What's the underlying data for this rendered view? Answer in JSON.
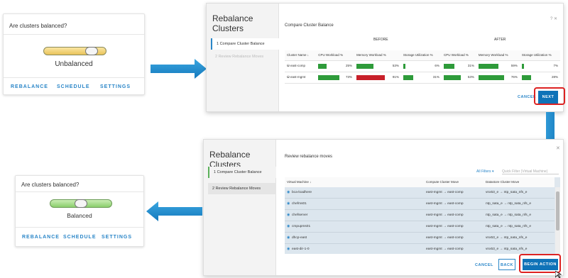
{
  "top_card": {
    "question": "Are clusters balanced?",
    "status": "Unbalanced",
    "actions": [
      "REBALANCE",
      "SCHEDULE",
      "SETTINGS"
    ]
  },
  "bottom_card": {
    "question": "Are clusters balanced?",
    "status": "Balanced",
    "actions": [
      "REBALANCE",
      "SCHEDULE",
      "SETTINGS"
    ]
  },
  "dialog1": {
    "title": "Rebalance Clusters",
    "steps": [
      "1  Compare Cluster Balance",
      "2  Review Rebalance Moves"
    ],
    "subtitle": "Compare Cluster Balance",
    "close": "? ✕",
    "group_before": "BEFORE",
    "group_after": "AFTER",
    "columns": [
      "Cluster Name ↓",
      "CPU Workload %",
      "Memory Workload %",
      "Storage Utilization %",
      "CPU Workload %",
      "Memory Workload %",
      "Storage Utilization %"
    ],
    "rows": [
      {
        "name": "east-comp",
        "vals": [
          "25%",
          "53%",
          "6%",
          "31%",
          "59%",
          "7%"
        ]
      },
      {
        "name": "east-mgmt",
        "vals": [
          "73%",
          "91%",
          "31%",
          "53%",
          "76%",
          "28%"
        ]
      }
    ],
    "cancel": "CANCEL",
    "next": "NEXT"
  },
  "dialog2": {
    "title": "Rebalance Clusters",
    "steps": [
      "1  Compare Cluster Balance",
      "2  Review Rebalance Moves"
    ],
    "subtitle": "Review rebalance moves",
    "filters": "All Filters ▾",
    "quick_filter": "Quick Filter (Virtual Machine)",
    "columns": [
      "Virtual Machine ↓",
      "Compute Cluster Move",
      "Datastore Cluster Move"
    ],
    "rows": [
      [
        "bca-loadhere",
        "east-mgmt → east-comp",
        "vnx53_e → ntp_sata_nfs_e"
      ],
      [
        "chefms01",
        "east-mgmt → east-comp",
        "ntp_sata_e → ntp_sata_nfs_e"
      ],
      [
        "chefserver",
        "east-mgmt → east-comp",
        "ntp_sata_e → ntp_sata_nfs_e"
      ],
      [
        "cmpupms01",
        "east-mgmt → east-comp",
        "ntp_sata_e → ntp_sata_nfs_e"
      ],
      [
        "dhcp-east",
        "east-mgmt → east-comp",
        "vnx53_e → ntp_sata_nfs_e"
      ],
      [
        "east-dir-1-0",
        "east-mgmt → east-comp",
        "vnx53_e → ntp_sata_nfs_e"
      ]
    ],
    "cancel": "CANCEL",
    "back": "BACK",
    "begin": "BEGIN ACTION"
  }
}
